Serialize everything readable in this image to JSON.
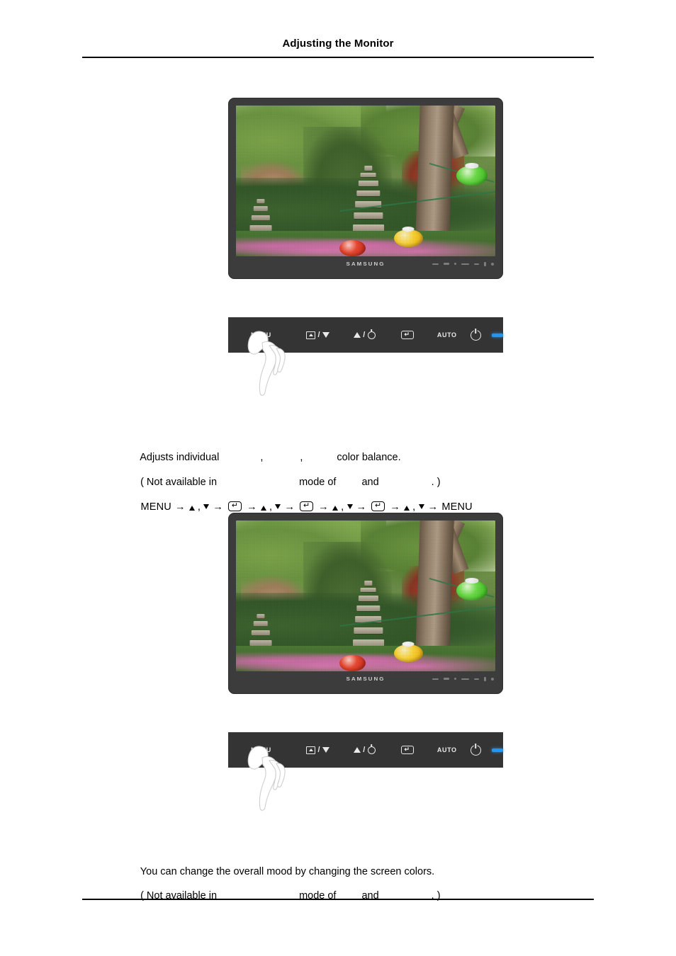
{
  "header": {
    "title": "Adjusting the Monitor"
  },
  "figures": [
    {
      "name": "monitor-preview-top",
      "brand": "SAMSUNG",
      "screen_alt": "Garden scene with stone pagoda, trees, flowers and paper lanterns"
    },
    {
      "name": "monitor-preview-bottom",
      "brand": "SAMSUNG",
      "screen_alt": "Garden scene with stone pagoda, trees, flowers and paper lanterns"
    }
  ],
  "control_panel": {
    "menu_label": "MENU",
    "auto_label": "AUTO",
    "buttons": [
      {
        "key": "menu",
        "label": "MENU",
        "icon": "menu-button"
      },
      {
        "key": "source_down",
        "label": "",
        "icon": "source-down-icon"
      },
      {
        "key": "up_brightness",
        "label": "",
        "icon": "up-brightness-icon"
      },
      {
        "key": "enter",
        "label": "",
        "icon": "enter-key-icon"
      },
      {
        "key": "auto",
        "label": "AUTO",
        "icon": "auto-button"
      },
      {
        "key": "power",
        "label": "",
        "icon": "power-icon"
      },
      {
        "key": "led",
        "label": "",
        "icon": "power-led-indicator"
      }
    ],
    "led_color": "#2196f3",
    "panel_color": "#343434"
  },
  "sections": [
    {
      "name": "color-balance-section",
      "line1_before": "Adjusts individual",
      "line1_sep1": ",",
      "line1_sep2": ",",
      "line1_after": "color balance.",
      "line2_open": "( Not available in",
      "line2_mid": "mode of",
      "line2_and": "and",
      "line2_close": ". )",
      "sequence_start": "MENU",
      "sequence_end": "MENU"
    },
    {
      "name": "color-tone-section",
      "line1": "You can change the overall mood by changing the screen colors.",
      "line2_open": "( Not available in",
      "line2_mid": "mode of",
      "line2_and": "and",
      "line2_close": ". )"
    }
  ]
}
